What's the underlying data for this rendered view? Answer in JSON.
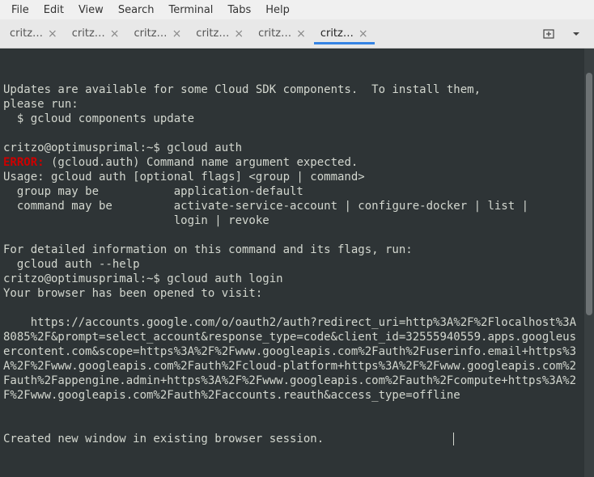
{
  "menubar": {
    "items": [
      "File",
      "Edit",
      "View",
      "Search",
      "Terminal",
      "Tabs",
      "Help"
    ]
  },
  "tabs": {
    "items": [
      {
        "label": "critz…"
      },
      {
        "label": "critz…"
      },
      {
        "label": "critz…"
      },
      {
        "label": "critz…"
      },
      {
        "label": "critz…"
      },
      {
        "label": "critz…"
      }
    ],
    "active_index": 5
  },
  "terminal": {
    "lines": [
      {
        "t": "",
        "cls": ""
      },
      {
        "t": "",
        "cls": ""
      },
      {
        "t": "Updates are available for some Cloud SDK components.  To install them,",
        "cls": ""
      },
      {
        "t": "please run:",
        "cls": ""
      },
      {
        "t": "  $ gcloud components update",
        "cls": ""
      },
      {
        "t": "",
        "cls": ""
      },
      {
        "t": "critzo@optimusprimal:~$ gcloud auth",
        "cls": ""
      },
      {
        "segments": [
          {
            "t": "ERROR:",
            "cls": "err"
          },
          {
            "t": " (gcloud.auth) Command name argument expected.",
            "cls": ""
          }
        ]
      },
      {
        "t": "Usage: gcloud auth [optional flags] <group | command>",
        "cls": ""
      },
      {
        "t": "  group may be           application-default",
        "cls": ""
      },
      {
        "t": "  command may be         activate-service-account | configure-docker | list |",
        "cls": ""
      },
      {
        "t": "                         login | revoke",
        "cls": ""
      },
      {
        "t": "",
        "cls": ""
      },
      {
        "t": "For detailed information on this command and its flags, run:",
        "cls": ""
      },
      {
        "t": "  gcloud auth --help",
        "cls": ""
      },
      {
        "t": "critzo@optimusprimal:~$ gcloud auth login",
        "cls": ""
      },
      {
        "t": "Your browser has been opened to visit:",
        "cls": ""
      },
      {
        "t": "",
        "cls": ""
      },
      {
        "t": "    https://accounts.google.com/o/oauth2/auth?redirect_uri=http%3A%2F%2Flocalhost%3A8085%2F&prompt=select_account&response_type=code&client_id=32555940559.apps.googleusercontent.com&scope=https%3A%2F%2Fwww.googleapis.com%2Fauth%2Fuserinfo.email+https%3A%2F%2Fwww.googleapis.com%2Fauth%2Fcloud-platform+https%3A%2F%2Fwww.googleapis.com%2Fauth%2Fappengine.admin+https%3A%2F%2Fwww.googleapis.com%2Fauth%2Fcompute+https%3A%2F%2Fwww.googleapis.com%2Fauth%2Faccounts.reauth&access_type=offline",
        "cls": ""
      },
      {
        "t": "",
        "cls": ""
      },
      {
        "t": "",
        "cls": ""
      },
      {
        "t": "Created new window in existing browser session.",
        "cls": ""
      }
    ]
  }
}
